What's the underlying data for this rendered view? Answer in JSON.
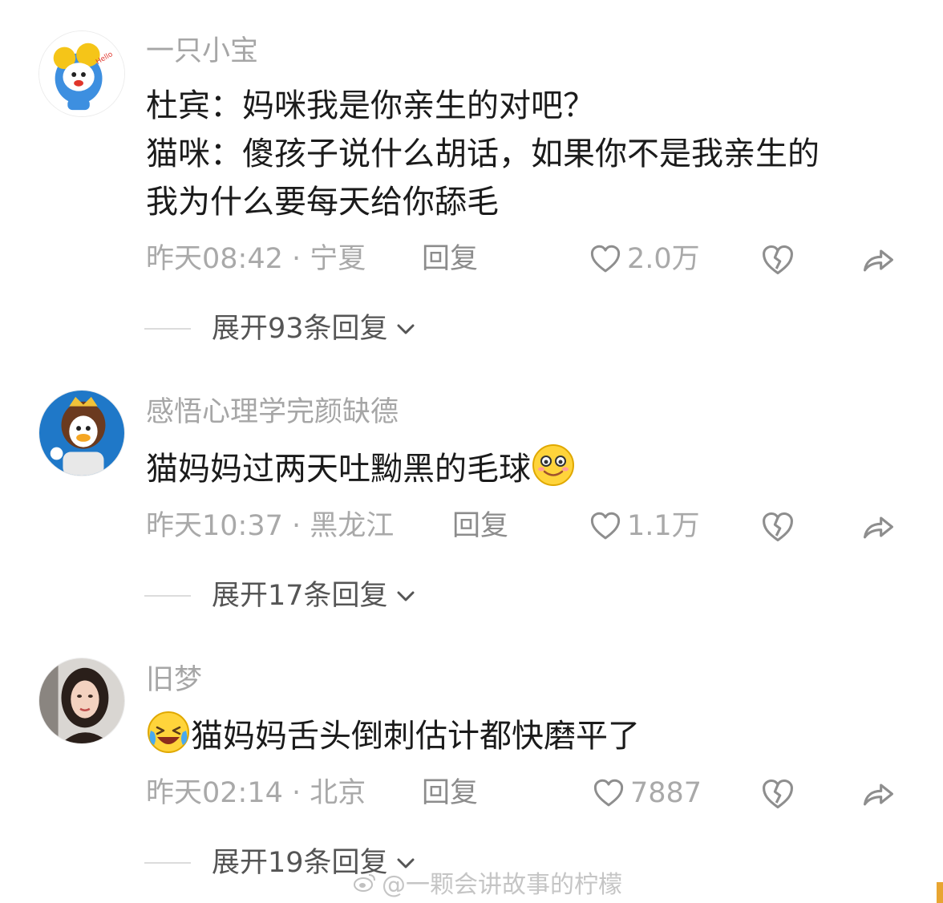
{
  "comments": [
    {
      "username": "一只小宝",
      "lines": [
        "杜宾：妈咪我是你亲生的对吧？",
        "猫咪：傻孩子说什么胡话，如果你不是我亲生的",
        "我为什么要每天给你舔毛"
      ],
      "time_location": "昨天08:42 · 宁夏",
      "reply_label": "回复",
      "likes": "2.0万",
      "expand_label": "展开93条回复"
    },
    {
      "username": "感悟心理学完颜缺德",
      "lines": [
        "猫妈妈过两天吐黝黑的毛球"
      ],
      "trailing_emoji": "smile-emoji",
      "time_location": "昨天10:37 · 黑龙江",
      "reply_label": "回复",
      "likes": "1.1万",
      "expand_label": "展开17条回复"
    },
    {
      "username": "旧梦",
      "lines": [
        "猫妈妈舌头倒刺估计都快磨平了"
      ],
      "leading_emoji": "laugh-cry-emoji",
      "time_location": "昨天02:14 · 北京",
      "reply_label": "回复",
      "likes": "7887",
      "expand_label": "展开19条回复"
    }
  ],
  "watermark": "@一颗会讲故事的柠檬",
  "icons": {
    "like": "heart-outline-icon",
    "dislike": "broken-heart-icon",
    "share": "share-arrow-icon",
    "expand": "chevron-down-icon"
  },
  "colors": {
    "username": "#a6a6a6",
    "text": "#1b1b1b",
    "meta": "#a9a9a9",
    "expand": "#555555"
  }
}
